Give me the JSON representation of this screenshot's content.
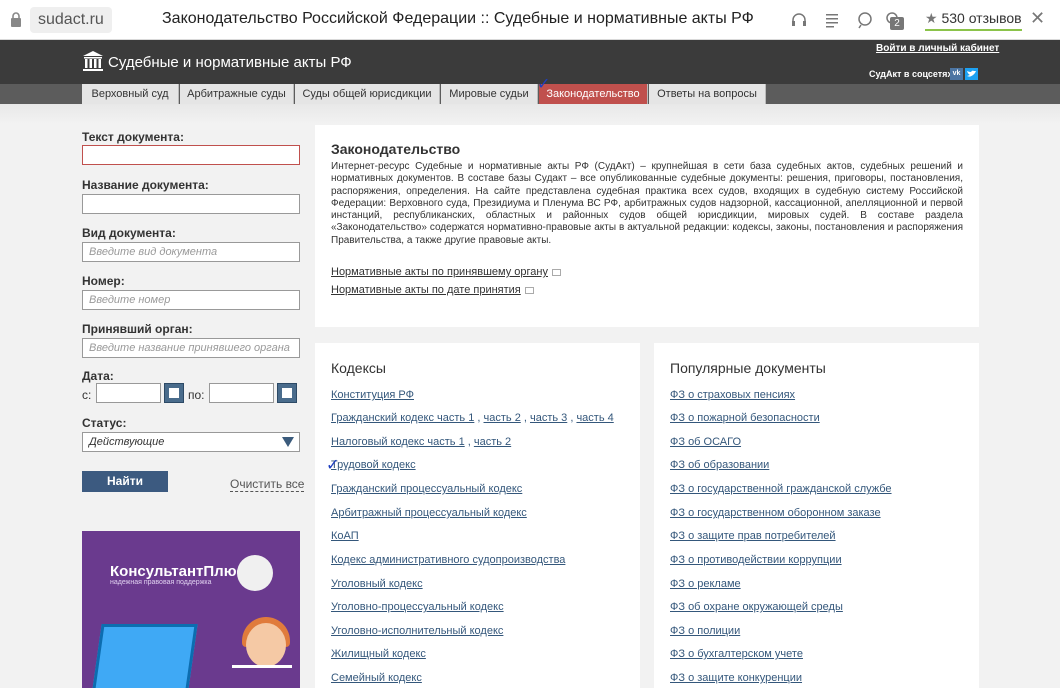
{
  "browser": {
    "url": "sudact.ru",
    "page_title": "Законодательство Российской Федерации :: Судебные и нормативные акты РФ",
    "reviews_label": "530 отзывов",
    "badge_count": "2"
  },
  "header": {
    "site_name": "Судебные и нормативные акты РФ",
    "cabinet_link": "Войти в личный кабинет",
    "social_label": "СудАкт в соцсетях",
    "vk_label": "vk"
  },
  "nav": {
    "tabs": [
      {
        "label": "Верховный суд"
      },
      {
        "label": "Арбитражные суды"
      },
      {
        "label": "Суды общей юрисдикции"
      },
      {
        "label": "Мировые судьи"
      },
      {
        "label": "Законодательство"
      },
      {
        "label": "Ответы на вопросы"
      }
    ]
  },
  "form": {
    "text_label": "Текст документа:",
    "name_label": "Название документа:",
    "type_label": "Вид документа:",
    "type_placeholder": "Введите вид документа",
    "number_label": "Номер:",
    "number_placeholder": "Введите номер",
    "organ_label": "Принявший орган:",
    "organ_placeholder": "Введите название принявшего органа",
    "date_label": "Дата:",
    "date_from": "с:",
    "date_to": "по:",
    "status_label": "Статус:",
    "status_value": "Действующие",
    "find_button": "Найти",
    "clear_link": "Очистить все"
  },
  "ad": {
    "title": "КонсультантПлюс",
    "subtitle": "надежная правовая поддержка"
  },
  "intro": {
    "title": "Законодательство",
    "description": "Интернет-ресурс Судебные и нормативные акты РФ (СудАкт) – крупнейшая в сети база судебных актов, судебных решений и нормативных документов. В составе базы Судакт – все опубликованные судебные документы: решения, приговоры, постановления, распоряжения, определения. На сайте представлена судебная практика всех судов, входящих в судебную систему Российской Федерации: Верховного суда, Президиума и Пленума ВС РФ, арбитражных судов надзорной, кассационной, апелляционной и первой инстанций, республиканских, областных и районных судов общей юрисдикции, мировых судей. В составе раздела «Законодательство» содержатся нормативно-правовые акты в актуальной редакции: кодексы, законы, постановления и распоряжения Правительства, а также другие правовые акты.",
    "link_by_organ": "Нормативные акты по принявшему органу",
    "link_by_date": "Нормативные акты по дате принятия"
  },
  "codes": {
    "title": "Кодексы",
    "items": [
      "Конституция РФ",
      "Гражданский кодекс часть 1",
      "часть 2",
      "часть 3",
      "часть 4",
      "Налоговый кодекс часть 1",
      "часть 2",
      "Трудовой кодекс",
      "Гражданский процессуальный кодекс",
      "Арбитражный процессуальный кодекс",
      "КоАП",
      "Кодекс административного судопроизводства",
      "Уголовный кодекс",
      "Уголовно-процессуальный кодекс",
      "Уголовно-исполнительный кодекс",
      "Жилищный кодекс",
      "Семейный кодекс"
    ]
  },
  "popular": {
    "title": "Популярные документы",
    "items": [
      "ФЗ о страховых пенсиях",
      "ФЗ о пожарной безопасности",
      "ФЗ об ОСАГО",
      "ФЗ об образовании",
      "ФЗ о государственной гражданской службе",
      "ФЗ о государственном оборонном заказе",
      "ФЗ о защите прав потребителей",
      "ФЗ о противодействии коррупции",
      "ФЗ о рекламе",
      "ФЗ об охране окружающей среды",
      "ФЗ о полиции",
      "ФЗ о бухгалтерском учете",
      "ФЗ о защите конкуренции"
    ]
  },
  "colors": {
    "accent_red": "#c0504d",
    "header_dark": "#3b3b3b",
    "button_blue": "#3c5a80",
    "link_blue": "#34577b"
  }
}
